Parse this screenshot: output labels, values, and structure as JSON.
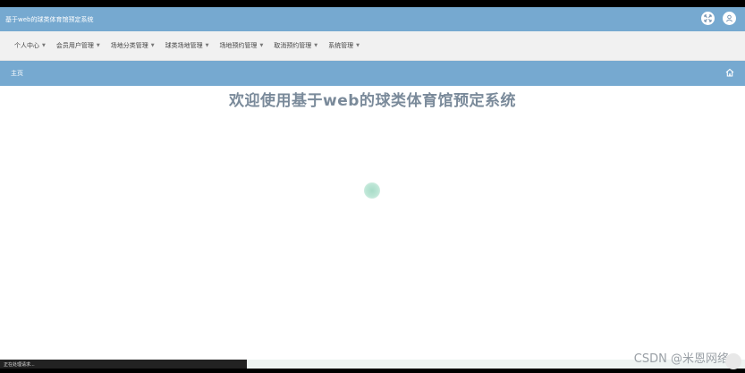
{
  "header": {
    "app_title": "基于web的球类体育馆预定系统",
    "icons": [
      "fullscreen-icon",
      "user-icon"
    ]
  },
  "menu": {
    "items": [
      {
        "label": "个人中心"
      },
      {
        "label": "会员用户管理"
      },
      {
        "label": "场地分类管理"
      },
      {
        "label": "球类场地管理"
      },
      {
        "label": "场地预约管理"
      },
      {
        "label": "取消预约管理"
      },
      {
        "label": "系统管理"
      }
    ]
  },
  "breadcrumb": {
    "home_label": "主页"
  },
  "main": {
    "welcome_text": "欢迎使用基于web的球类体育馆预定系统"
  },
  "status": {
    "text": "正在处理请求..."
  },
  "watermark": {
    "text": "CSDN @米恩网络"
  },
  "colors": {
    "primary": "#76a9d0",
    "menu_bg": "#f1f1f1",
    "welcome_text": "#7a8a9a",
    "spinner": "#a8dcc8"
  }
}
